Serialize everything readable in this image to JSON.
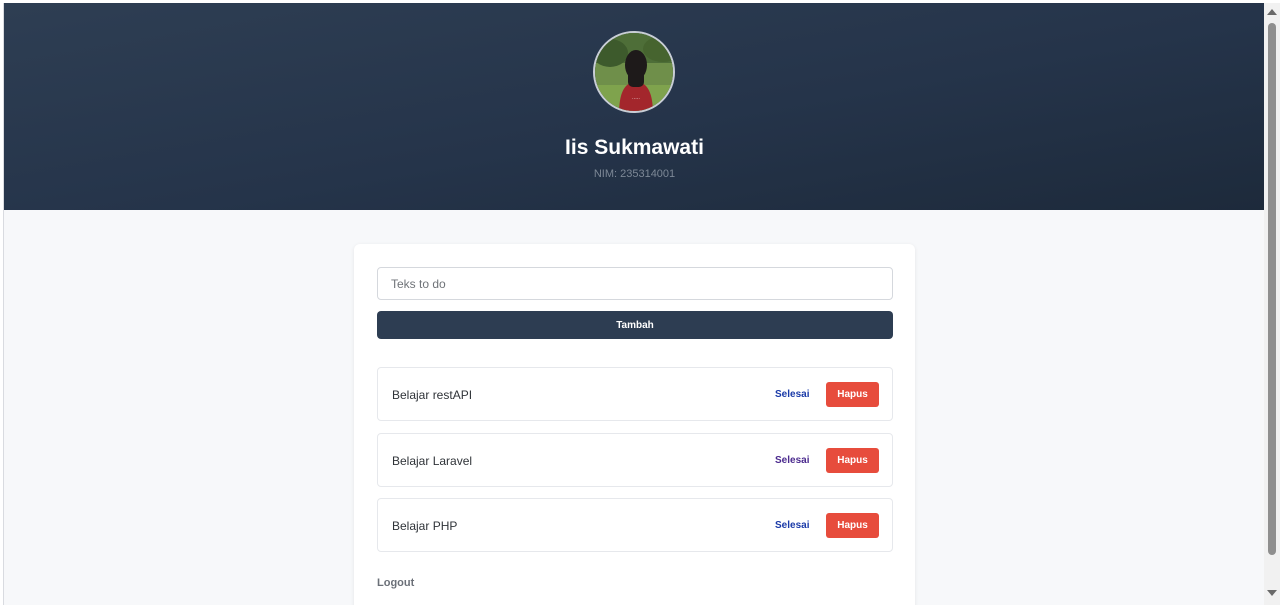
{
  "profile": {
    "name": "Iis Sukmawati",
    "nim": "NIM: 235314001"
  },
  "form": {
    "placeholder": "Teks to do",
    "value": "",
    "add_label": "Tambah"
  },
  "todos": [
    {
      "text": "Belajar restAPI",
      "done_label": "Selesai",
      "delete_label": "Hapus"
    },
    {
      "text": "Belajar Laravel",
      "done_label": "Selesai",
      "delete_label": "Hapus"
    },
    {
      "text": "Belajar PHP",
      "done_label": "Selesai",
      "delete_label": "Hapus"
    }
  ],
  "logout_label": "Logout",
  "colors": {
    "header": "#2d3d52",
    "add_button": "#2d3d52",
    "delete_button": "#e74c3c",
    "done_link": "#1a3aa8"
  }
}
